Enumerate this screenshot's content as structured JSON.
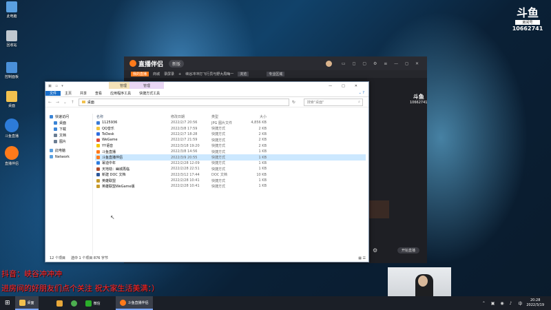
{
  "desktop": {
    "icons": [
      {
        "label": "此电脑",
        "color": "#5aa0e0"
      },
      {
        "label": "回收站",
        "color": "#c0c8d0"
      },
      {
        "label": "控制面板",
        "color": "#4a90d9"
      },
      {
        "label": "桌面",
        "color": "#f2c14e"
      },
      {
        "label": "斗鱼直播",
        "color": "#2d7bd8"
      },
      {
        "label": "直播伴侣",
        "color": "#ff7a1a"
      }
    ]
  },
  "logo": {
    "brand": "斗鱼",
    "sub": "房间号",
    "room": "10662741"
  },
  "stream_app": {
    "title": "直播伴侣",
    "badge": "新版",
    "tabs": [
      "我的直播",
      "商城",
      "录屏录",
      "+",
      "峡谷冲冲打飞行员与野大局晦一",
      "浏览",
      "专业区域"
    ],
    "mini_logo": "斗鱼",
    "mini_room": "10662741",
    "live_button": "开始直播"
  },
  "explorer": {
    "title": "桌面",
    "ctx_tabs": [
      "管理",
      "管理"
    ],
    "ribbon": [
      "文件",
      "主页",
      "共享",
      "查看",
      "应用程序工具",
      "快捷方式工具"
    ],
    "path": "桌面",
    "search_placeholder": "搜索\"桌面\"",
    "nav": [
      {
        "label": "快速访问",
        "color": "#3a84d6"
      },
      {
        "label": "桌面",
        "color": "#3a84d6"
      },
      {
        "label": "下载",
        "color": "#3a84d6"
      },
      {
        "label": "文档",
        "color": "#6a7d92"
      },
      {
        "label": "图片",
        "color": "#6a7d92"
      },
      {
        "label": "此电脑",
        "color": "#5aa0e0"
      },
      {
        "label": "Network",
        "color": "#5aa0e0"
      }
    ],
    "columns": [
      "名称",
      "修改日期",
      "类型",
      "大小"
    ],
    "files": [
      {
        "name": "1125936",
        "date": "2022/2/7 20:56",
        "type": "JPG 图片文件",
        "size": "4,856 KB",
        "color": "#3b7bd6"
      },
      {
        "name": "QQ音乐",
        "date": "2022/3/8 17:59",
        "type": "快捷方式",
        "size": "2 KB",
        "color": "#f2c43a"
      },
      {
        "name": "ToDesk",
        "date": "2022/2/7 18:28",
        "type": "快捷方式",
        "size": "2 KB",
        "color": "#2f6de0"
      },
      {
        "name": "WeGame",
        "date": "2022/2/7 21:59",
        "type": "快捷方式",
        "size": "2 KB",
        "color": "#e04a3a"
      },
      {
        "name": "YY语音",
        "date": "2022/3/18 19:20",
        "type": "快捷方式",
        "size": "2 KB",
        "color": "#f5c400"
      },
      {
        "name": "斗鱼直播",
        "date": "2022/3/8 14:56",
        "type": "快捷方式",
        "size": "1 KB",
        "color": "#ff7a1a"
      },
      {
        "name": "斗鱼直播伴侣",
        "date": "2022/3/9 20:55",
        "type": "快捷方式",
        "size": "1 KB",
        "color": "#ff7a1a"
      },
      {
        "name": "幂迪中年",
        "date": "2022/2/28 12:09",
        "type": "快捷方式",
        "size": "1 KB",
        "color": "#2f7de0"
      },
      {
        "name": "天地劫：幽城再临",
        "date": "2022/2/28 22:51",
        "type": "快捷方式",
        "size": "1 KB",
        "color": "#b04a2a"
      },
      {
        "name": "新建 DOC 文档",
        "date": "2022/3/12 17:44",
        "type": "DOC 文档",
        "size": "10 KB",
        "color": "#2b579a"
      },
      {
        "name": "英雄联盟",
        "date": "2022/2/28 10:41",
        "type": "快捷方式",
        "size": "1 KB",
        "color": "#c79a2a"
      },
      {
        "name": "英雄联盟WeGame版",
        "date": "2022/2/28 10:41",
        "type": "快捷方式",
        "size": "1 KB",
        "color": "#c79a2a"
      }
    ],
    "selected_index": 6,
    "status": {
      "count": "12 个项目",
      "selected": "选中 1 个项目  876 字节"
    }
  },
  "overlay": {
    "line1": "抖音：峡谷冲冲冲",
    "line2": "进房间的好朋友们点个关注 祝大家生活美满：）"
  },
  "taskbar": {
    "apps": [
      {
        "label": "桌面",
        "color": "#f2c14e",
        "active": true
      },
      {
        "label": "",
        "color": "#e8a83a",
        "active": false
      },
      {
        "label": "",
        "color": "#4caf50",
        "active": false
      },
      {
        "label": "微信",
        "color": "#2aae2a",
        "active": false
      },
      {
        "label": "斗鱼直播伴侣",
        "color": "#ff7a1a",
        "active": true
      }
    ],
    "time": "20:28",
    "date": "2022/3/19",
    "ime": "中"
  }
}
